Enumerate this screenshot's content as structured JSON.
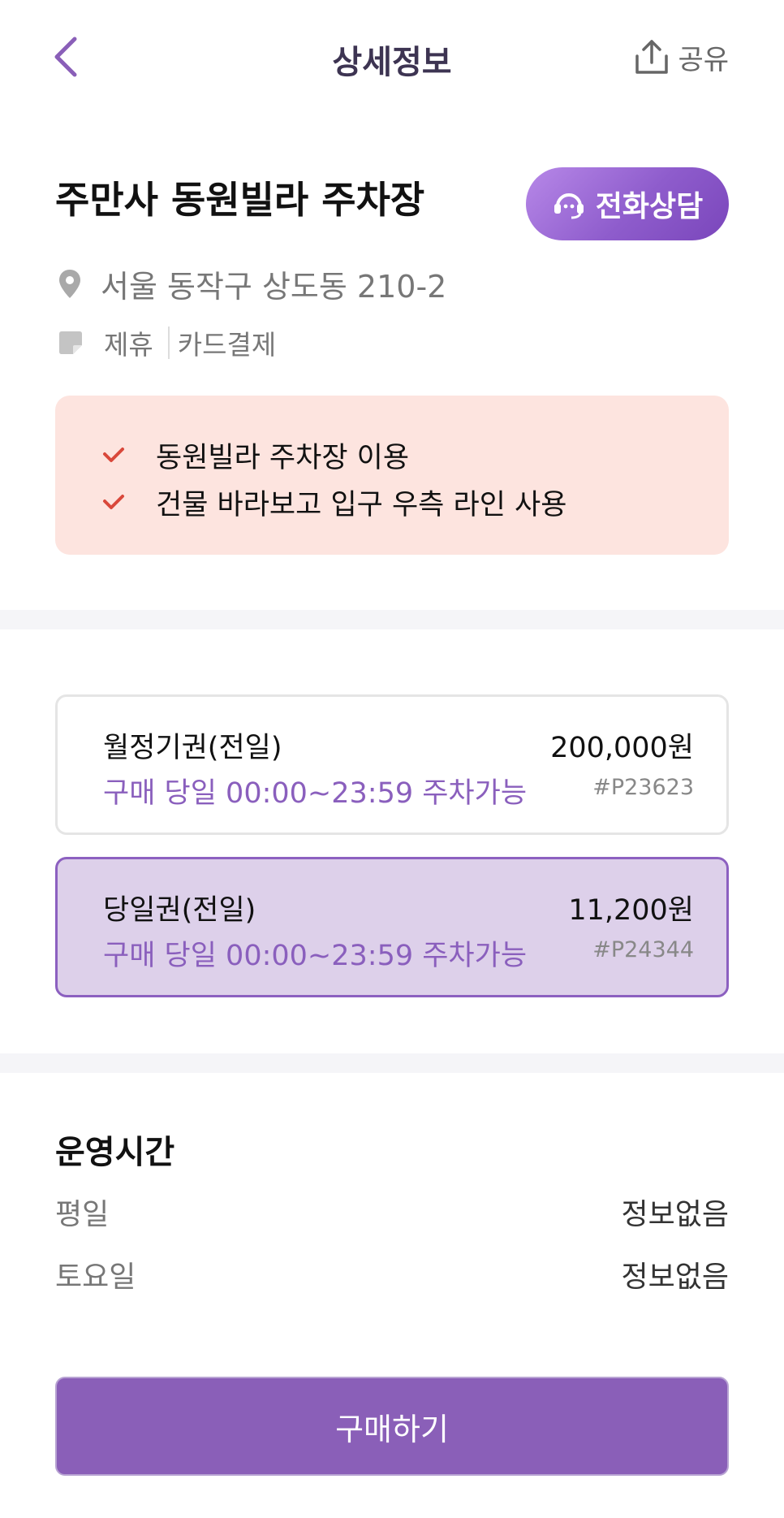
{
  "header": {
    "title": "상세정보",
    "share_label": "공유"
  },
  "lot": {
    "name": "주만사 동원빌라 주차장",
    "call_label": "전화상담",
    "address": "서울 동작구 상도동 210-2",
    "tags": [
      "제휴",
      "카드결제"
    ]
  },
  "notice": {
    "items": [
      "동원빌라 주차장 이용",
      "건물 바라보고 입구 우측 라인 사용"
    ]
  },
  "tickets": [
    {
      "name": "월정기권(전일)",
      "price": "200,000원",
      "time": "구매 당일 00:00~23:59 주차가능",
      "code": "#P23623",
      "selected": false
    },
    {
      "name": "당일권(전일)",
      "price": "11,200원",
      "time": "구매 당일 00:00~23:59 주차가능",
      "code": "#P24344",
      "selected": true
    }
  ],
  "hours": {
    "title": "운영시간",
    "rows": [
      {
        "label": "평일",
        "value": "정보없음"
      },
      {
        "label": "토요일",
        "value": "정보없음"
      }
    ]
  },
  "purchase_label": "구매하기",
  "colors": {
    "accent": "#8a5fb8",
    "selected_bg": "#ddd0ea",
    "notice_bg": "#fde4df",
    "check": "#d9483b"
  }
}
